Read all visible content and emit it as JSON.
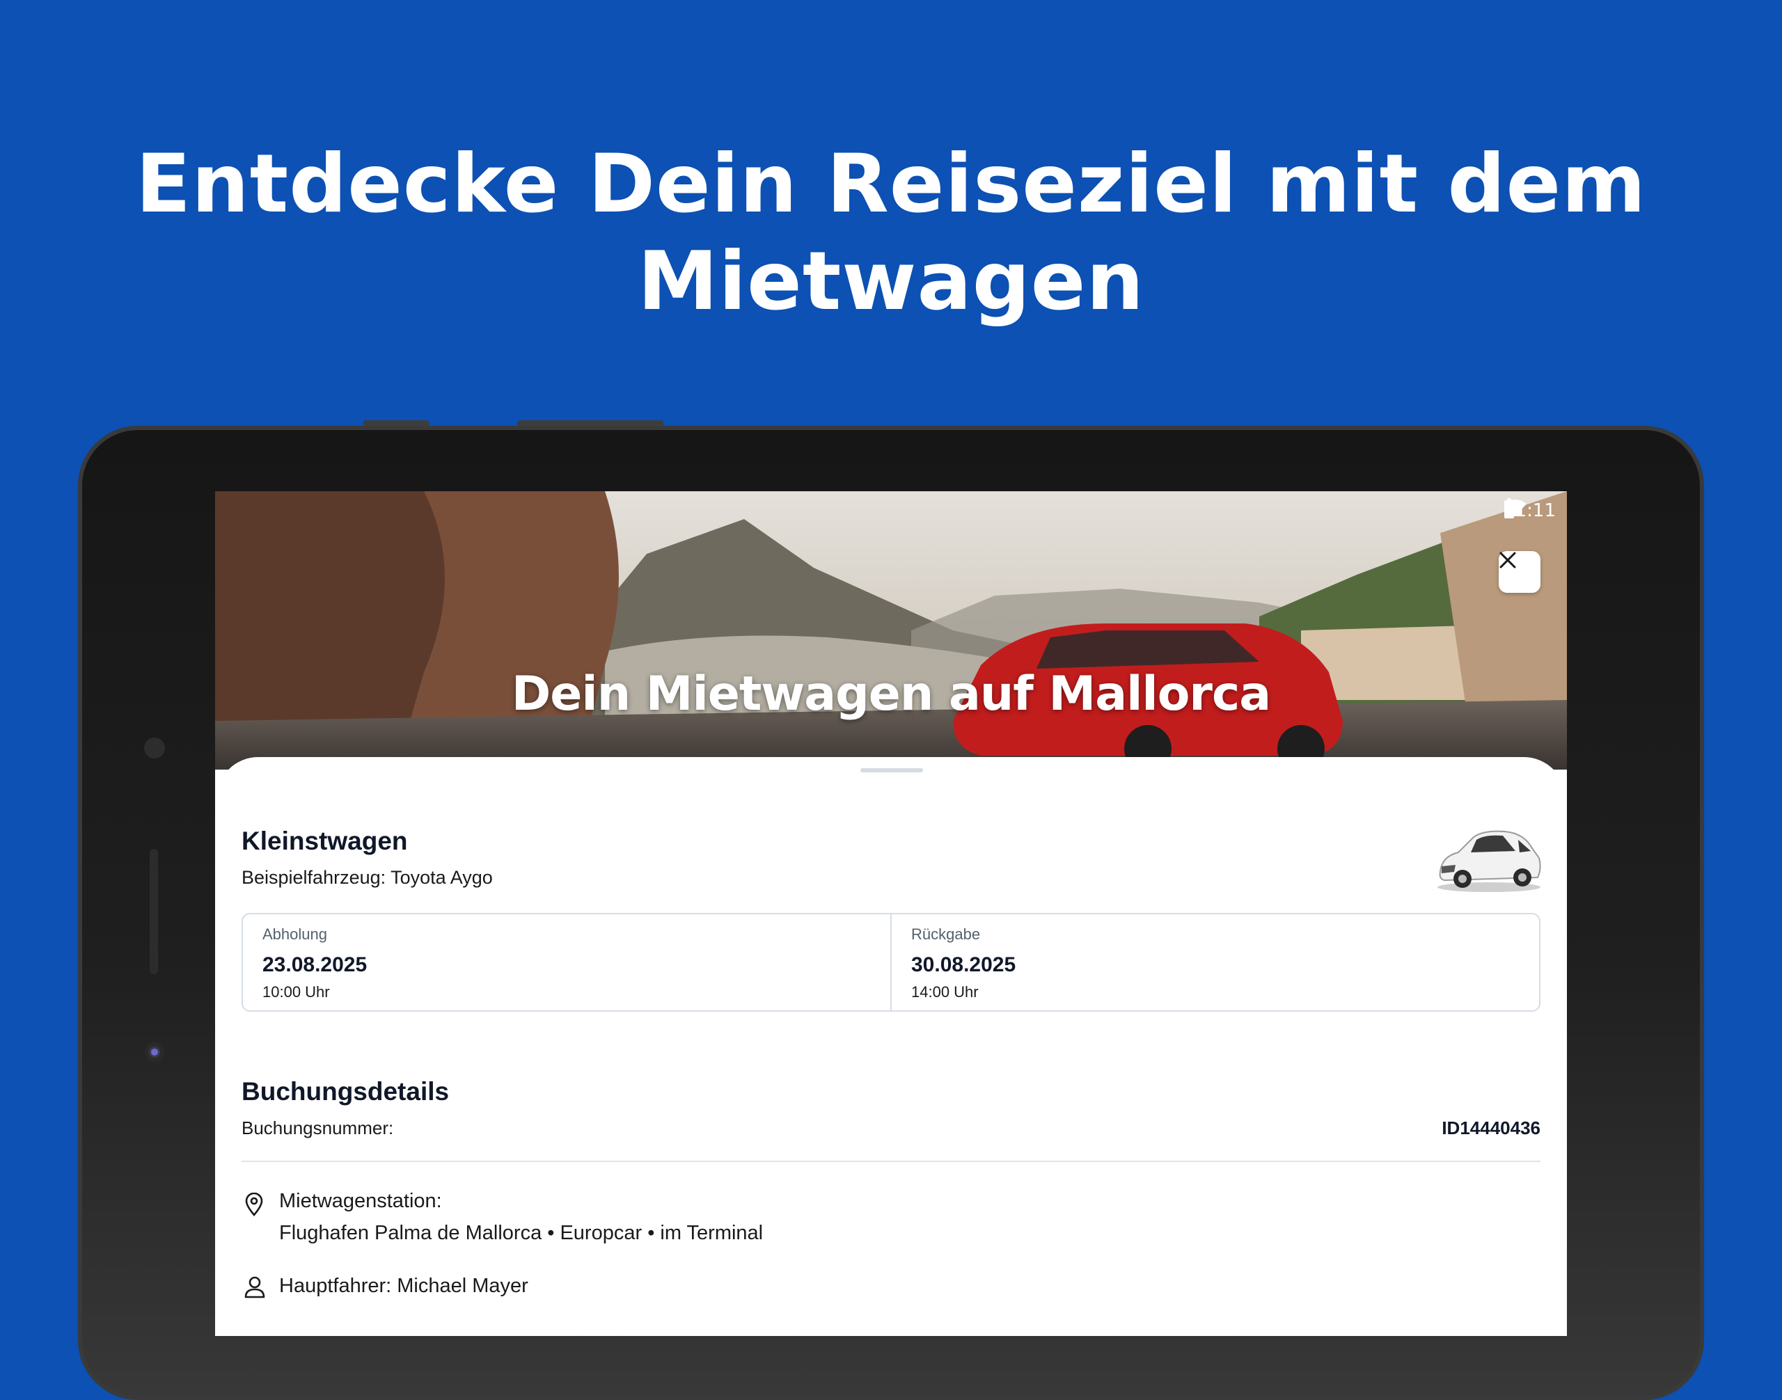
{
  "promo": {
    "headline_line1": "Entdecke Dein Reiseziel mit dem",
    "headline_line2": "Mietwagen"
  },
  "status_bar": {
    "time": "11:11",
    "icons": [
      "wifi-icon",
      "signal-icon",
      "battery-icon"
    ]
  },
  "hero": {
    "title": "Dein Mietwagen auf Mallorca",
    "close_icon": "close-icon"
  },
  "vehicle": {
    "class_name": "Kleinstwagen",
    "example": "Beispielfahrzeug: Toyota Aygo"
  },
  "rental_period": {
    "pickup": {
      "label": "Abholung",
      "date": "23.08.2025",
      "time": "10:00 Uhr"
    },
    "return": {
      "label": "Rückgabe",
      "date": "30.08.2025",
      "time": "14:00 Uhr"
    }
  },
  "booking": {
    "heading": "Buchungsdetails",
    "number_label": "Buchungsnummer:",
    "number_value": "ID14440436",
    "station_label": "Mietwagenstation:",
    "station_value": "Flughafen Palma de Mallorca • Europcar • im Terminal",
    "driver": "Hauptfahrer: Michael Mayer"
  },
  "colors": {
    "background": "#0c51b3",
    "text_dark": "#101828",
    "border": "#d7dde6"
  }
}
